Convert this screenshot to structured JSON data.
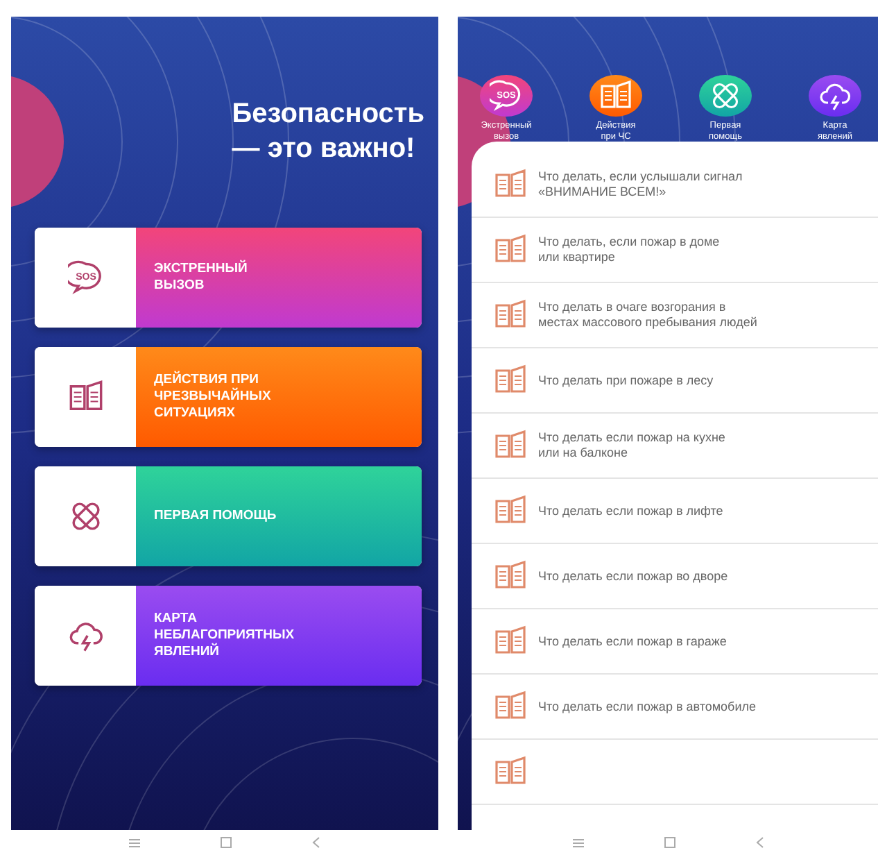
{
  "home_screen": {
    "title": "Безопасность\n— это важно!",
    "cards": [
      {
        "kind": "sos",
        "icon_text": "SOS",
        "label": "ЭКСТРЕННЫЙ\nВЫЗОВ"
      },
      {
        "kind": "book",
        "label": "ДЕЙСТВИЯ ПРИ\nЧРЕЗВЫЧАЙНЫХ\nСИТУАЦИЯХ"
      },
      {
        "kind": "aid",
        "label": "ПЕРВАЯ ПОМОЩЬ"
      },
      {
        "kind": "storm",
        "label": "КАРТА\nНЕБЛАГОПРИЯТНЫХ\nЯВЛЕНИЙ"
      }
    ]
  },
  "list_screen": {
    "categories": [
      {
        "kind": "sos",
        "icon_text": "SOS",
        "label": "Экстренный\nвызов"
      },
      {
        "kind": "book",
        "label": "Действия\nпри ЧС"
      },
      {
        "kind": "aid",
        "label": "Первая\nпомощь"
      },
      {
        "kind": "storm",
        "label": "Карта\nявлений"
      }
    ],
    "items": [
      {
        "kind": "article",
        "text": "Что делать, если услышали сигнал\n«ВНИМАНИЕ ВСЕМ!»"
      },
      {
        "kind": "article",
        "text": "Что делать, если пожар в доме\nили квартире"
      },
      {
        "kind": "article",
        "text": "Что делать в очаге возгорания в\nместах массового пребывания людей"
      },
      {
        "kind": "article",
        "text": "Что делать при пожаре в лесу"
      },
      {
        "kind": "article",
        "text": "Что делать если пожар на кухне\nили на балконе"
      },
      {
        "kind": "article",
        "text": "Что делать если пожар в лифте"
      },
      {
        "kind": "article",
        "text": "Что делать если пожар во дворе"
      },
      {
        "kind": "article",
        "text": "Что делать если пожар в гараже"
      },
      {
        "kind": "article",
        "text": "Что делать если пожар в автомобиле"
      },
      {
        "kind": "partial"
      }
    ]
  }
}
